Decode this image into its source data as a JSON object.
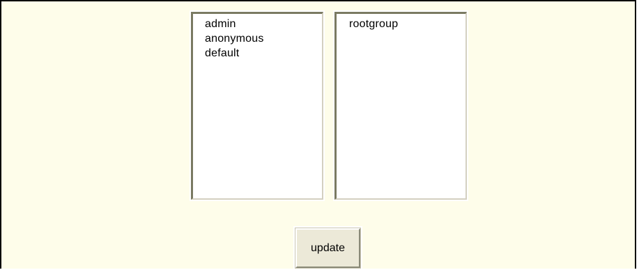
{
  "available_users": {
    "items": [
      {
        "label": "admin"
      },
      {
        "label": "anonymous"
      },
      {
        "label": "default"
      }
    ]
  },
  "assigned_groups": {
    "items": [
      {
        "label": "rootgroup"
      }
    ]
  },
  "actions": {
    "update_label": "update"
  },
  "colors": {
    "panel_background": "#fefdea",
    "panel_border": "#000000",
    "listbox_background": "#ffffff",
    "button_face": "#ece9d8"
  }
}
